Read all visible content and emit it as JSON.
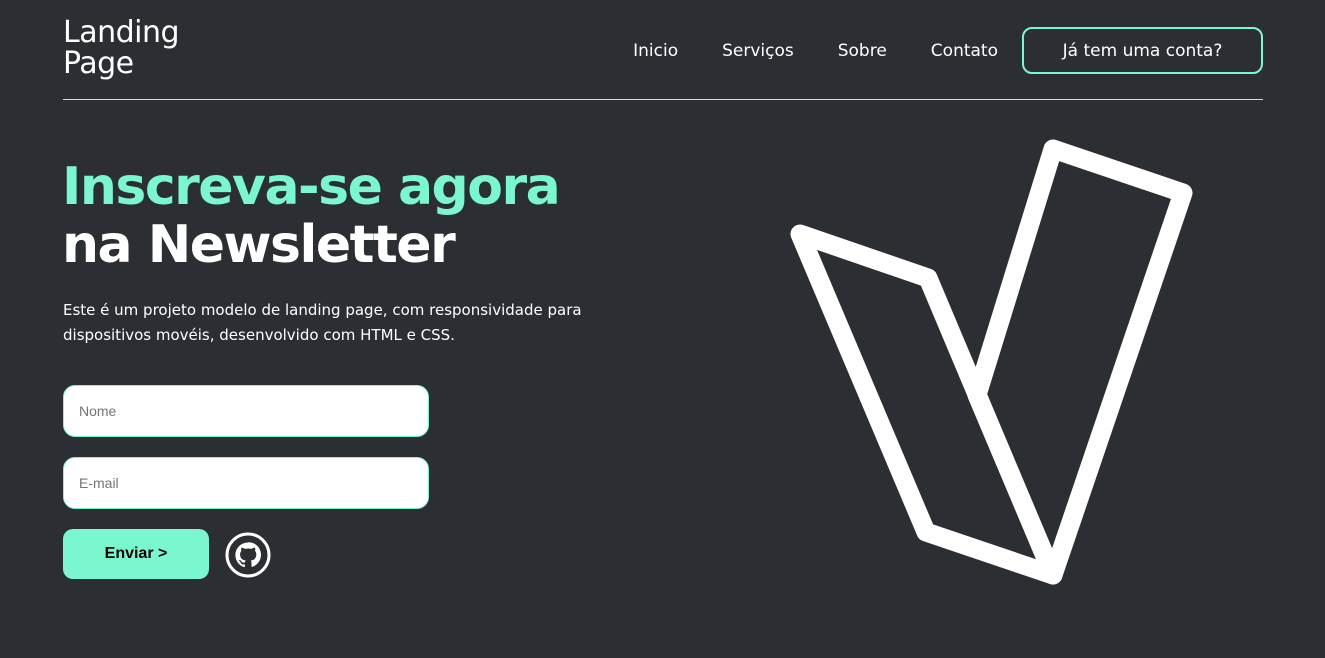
{
  "header": {
    "logo_line1": "Landing",
    "logo_line2": "Page",
    "nav": [
      "Inicio",
      "Serviços",
      "Sobre",
      "Contato"
    ],
    "account_button": "Já tem uma conta?"
  },
  "hero": {
    "headline_accent": "Inscreva-se agora",
    "headline_white": "na Newsletter",
    "description": "Este é um projeto modelo de landing page, com responsividade para dispositivos movéis, desenvolvido com HTML e CSS."
  },
  "form": {
    "name_placeholder": "Nome",
    "email_placeholder": "E-mail",
    "submit_label": "Enviar >"
  },
  "icons": {
    "github": "github-icon",
    "hero_graphic": "checkmark-logo-icon"
  },
  "colors": {
    "background": "#2b2e33",
    "accent": "#7bf7cf",
    "text": "#ffffff"
  }
}
